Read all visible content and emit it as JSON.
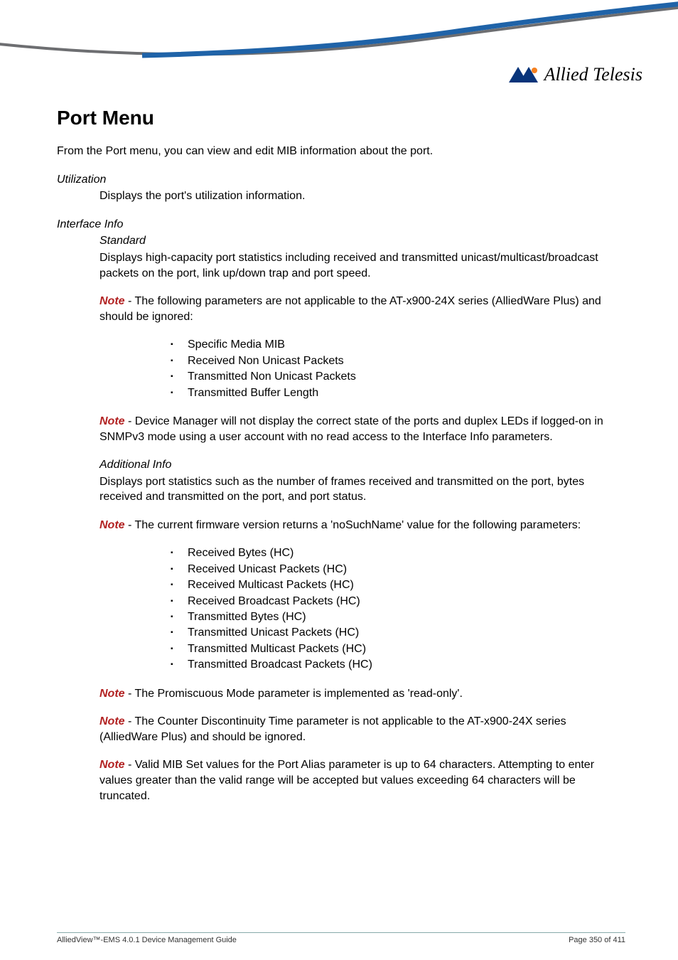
{
  "brand": "Allied Telesis",
  "title": "Port Menu",
  "intro": "From the Port menu, you can view and edit MIB information about the port.",
  "utilization": {
    "label": "Utilization",
    "desc": "Displays the port's utilization information."
  },
  "interface_info": {
    "label": "Interface Info",
    "standard": {
      "label": "Standard",
      "desc": "Displays high-capacity port statistics including received and transmitted unicast/multicast/broadcast packets on the port, link up/down trap and port speed.",
      "note1_prefix": "Note",
      "note1_body": " - The following parameters are not applicable to the AT-x900-24X series (AlliedWare Plus) and should be ignored:",
      "note1_items": [
        "Specific Media MIB",
        "Received Non Unicast Packets",
        "Transmitted Non Unicast Packets",
        "Transmitted Buffer Length"
      ],
      "note2_prefix": "Note",
      "note2_body": " - Device Manager will not display the correct state of the ports and duplex LEDs if logged-on in SNMPv3 mode using a user account with no read access to the Interface Info parameters."
    },
    "additional": {
      "label": "Additional Info",
      "desc": "Displays port statistics such as the number of frames received and transmitted on the port, bytes received and transmitted on the port, and port status.",
      "note1_prefix": "Note",
      "note1_body": " - The current firmware version returns a 'noSuchName' value for the following parameters:",
      "note1_items": [
        "Received Bytes (HC)",
        "Received Unicast Packets (HC)",
        "Received Multicast Packets (HC)",
        "Received Broadcast Packets (HC)",
        "Transmitted Bytes (HC)",
        "Transmitted Unicast Packets (HC)",
        "Transmitted Multicast Packets (HC)",
        "Transmitted Broadcast Packets (HC)"
      ],
      "note2_prefix": "Note",
      "note2_body": " - The Promiscuous Mode parameter is implemented as 'read-only'.",
      "note3_prefix": "Note",
      "note3_body": " - The Counter Discontinuity Time parameter is not applicable to the AT-x900-24X series (AlliedWare Plus) and should be ignored.",
      "note4_prefix": "Note",
      "note4_body": " - Valid MIB Set values for the Port Alias parameter is up to 64 characters. Attempting to enter values greater than the valid range will be accepted but values exceeding 64 characters will be truncated."
    }
  },
  "footer": {
    "left": "AlliedView™-EMS 4.0.1 Device Management Guide",
    "right": "Page 350 of 411"
  }
}
